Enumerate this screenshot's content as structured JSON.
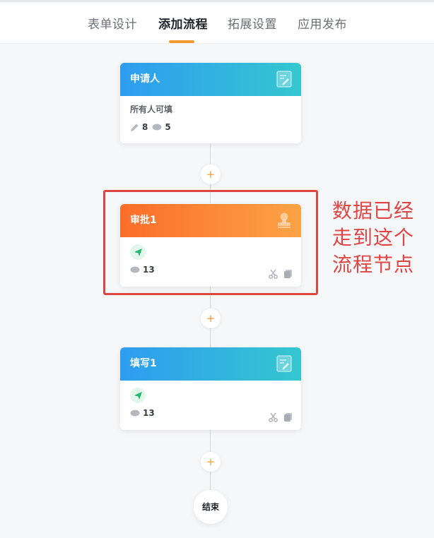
{
  "tabs": [
    {
      "label": "表单设计"
    },
    {
      "label": "添加流程"
    },
    {
      "label": "拓展设置"
    },
    {
      "label": "应用发布"
    }
  ],
  "active_tab": "添加流程",
  "nodes": [
    {
      "title": "申请人",
      "subtitle": "所有人可填",
      "edit_count": "8",
      "view_count": "5",
      "color": "#2e9cf1"
    },
    {
      "title": "审批1",
      "view_count": "13",
      "color": "#fb6d2a"
    },
    {
      "title": "填写1",
      "view_count": "13",
      "color": "#2e9cf1"
    }
  ],
  "add_label": "+",
  "end_label": "结束",
  "annotation": {
    "lines": [
      "数据已经",
      "走到这个",
      "流程节点"
    ],
    "color": "#e04545"
  },
  "colors": {
    "accent": "#f49a32",
    "send_icon": "#20b86a"
  }
}
